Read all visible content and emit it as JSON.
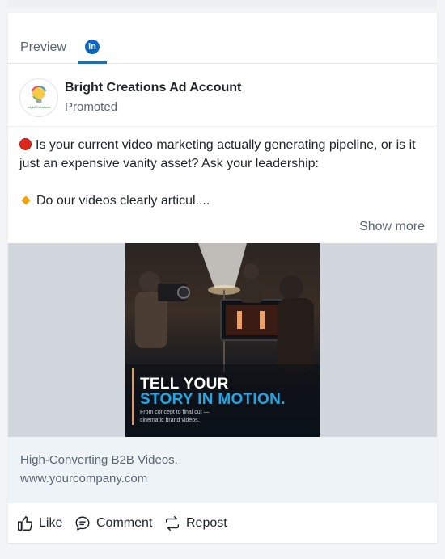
{
  "tabs": {
    "preview_label": "Preview",
    "linkedin_badge": "in"
  },
  "post": {
    "account_name": "Bright Creations Ad Account",
    "status": "Promoted",
    "avatar_text": "bright Creations",
    "line1": "Is your current video marketing actually generating pipeline, or is it just an expensive vanity asset? Ask your leadership:",
    "line2": "Do our videos clearly articul....",
    "show_more": "Show more"
  },
  "creative": {
    "headline_1": "TELL YOUR",
    "headline_2": "STORY IN MOTION.",
    "subline_1": "From concept to final cut —",
    "subline_2": "cinematic brand videos."
  },
  "footer": {
    "title": "High-Converting B2B Videos.",
    "url": "www.yourcompany.com"
  },
  "actions": {
    "like": "Like",
    "comment": "Comment",
    "repost": "Repost"
  },
  "colors": {
    "linkedin_blue": "#0a66c2",
    "headline_accent": "#1fa7e8",
    "stop_red": "#e0251b",
    "diamond_orange": "#f5a10b"
  },
  "icons": [
    "linkedin-icon",
    "stop-emoji-icon",
    "diamond-emoji-icon",
    "thumbs-up-icon",
    "comment-icon",
    "repost-icon"
  ]
}
